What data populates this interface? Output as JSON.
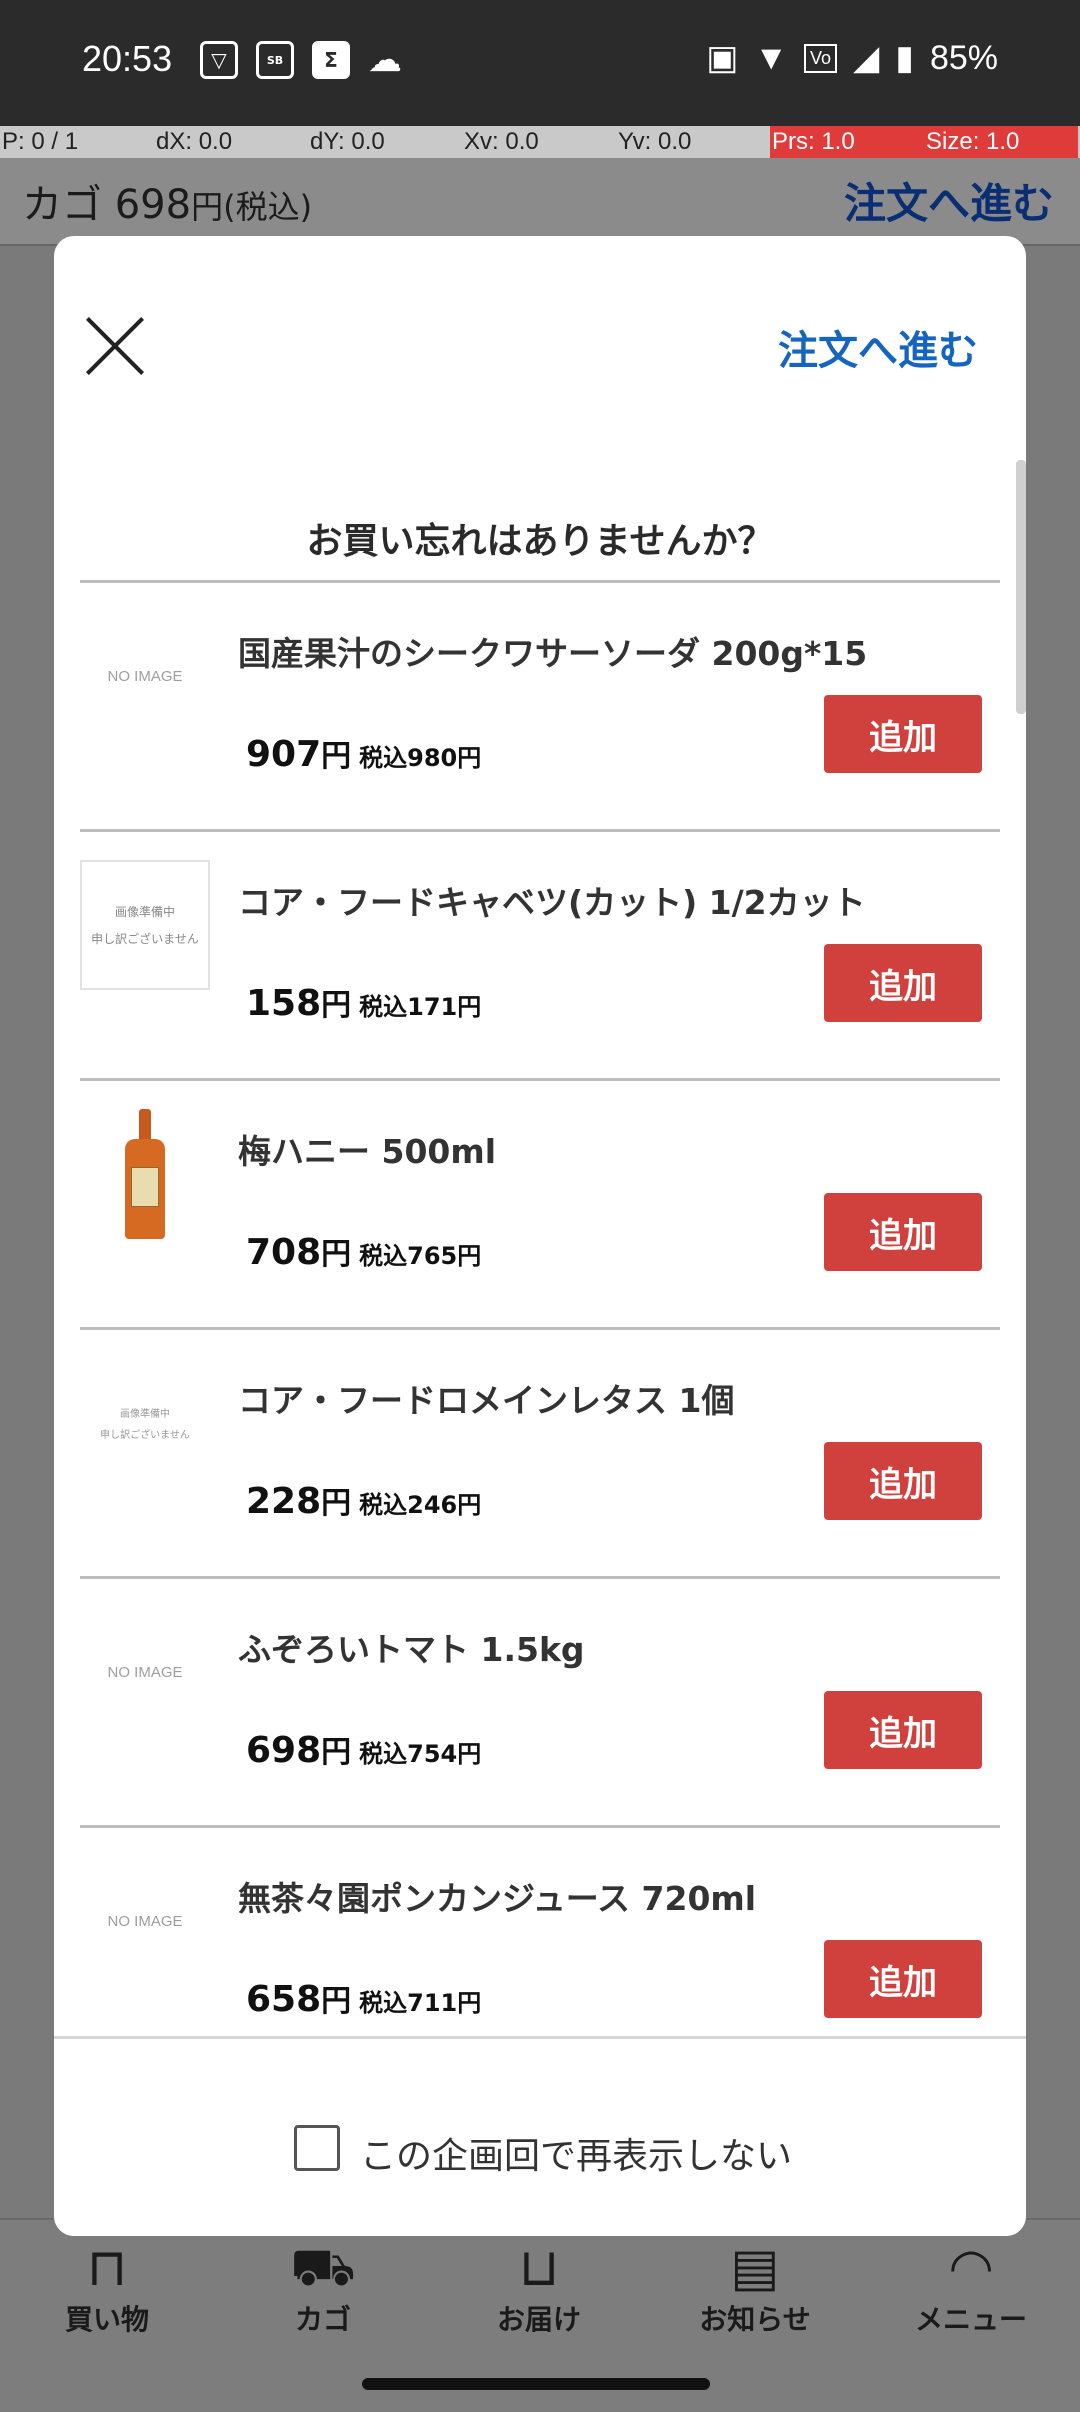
{
  "status_bar": {
    "time": "20:53",
    "icons_left": [
      "vpn-icon",
      "sportsbull-icon",
      "sigma-icon",
      "cloud-icon"
    ],
    "battery": "85%"
  },
  "pointer_bar": [
    "P: 0 / 1",
    "dX: 0.0",
    "dY: 0.0",
    "Xv: 0.0",
    "Yv: 0.0",
    "Prs: 1.0",
    "Size: 1.0"
  ],
  "background": {
    "cart_label": "カゴ",
    "cart_amount": "698",
    "cart_unit": "円(税込)",
    "go_order": "注文へ進む",
    "nav": [
      "買い物",
      "カゴ",
      "お届け",
      "お知らせ",
      "メニュー"
    ]
  },
  "modal": {
    "go_order": "注文へ進む",
    "question": "お買い忘れはありませんか？",
    "add_label": "追加",
    "yen": "円",
    "items": [
      {
        "name": "国産果汁のシークワサーソーダ 200g*15",
        "price": "907",
        "tax": "税込980円",
        "image": "no-image"
      },
      {
        "name": "コア・フードキャベツ(カット) 1/2カット",
        "price": "158",
        "tax": "税込171円",
        "image": "preparing"
      },
      {
        "name": "梅ハニー 500ml",
        "price": "708",
        "tax": "税込765円",
        "image": "bottle"
      },
      {
        "name": "コア・フードロメインレタス 1個",
        "price": "228",
        "tax": "税込246円",
        "image": "preparing-small"
      },
      {
        "name": "ふぞろいトマト 1.5kg",
        "price": "698",
        "tax": "税込754円",
        "image": "no-image"
      },
      {
        "name": "無茶々園ポンカンジュース 720ml",
        "price": "658",
        "tax": "税込711円",
        "image": "no-image"
      }
    ],
    "no_image_text": "NO IMAGE",
    "preparing_text_1": "画像準備中",
    "preparing_text_2": "申し訳ございません",
    "dont_show_again": "この企画回で再表示しない"
  }
}
